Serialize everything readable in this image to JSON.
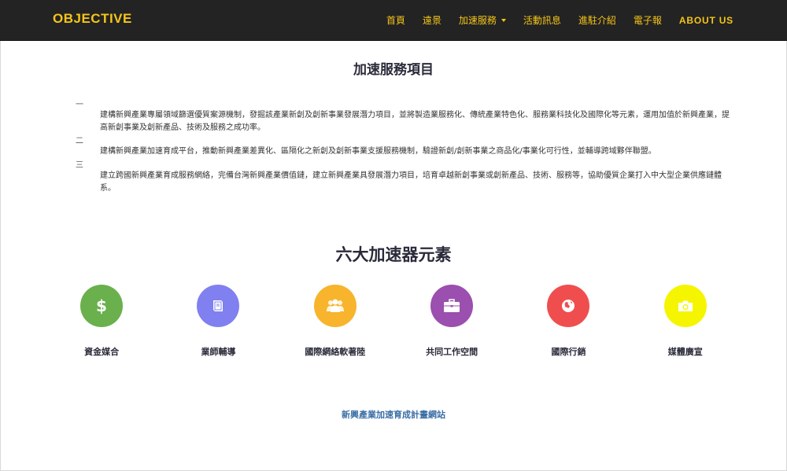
{
  "header": {
    "brand": "OBJECTIVE",
    "nav": [
      {
        "label": "首頁"
      },
      {
        "label": "遠景"
      },
      {
        "label": "加速服務"
      },
      {
        "label": "活動訊息"
      },
      {
        "label": "進駐介紹"
      },
      {
        "label": "電子報"
      },
      {
        "label": "ABOUT US"
      }
    ]
  },
  "services": {
    "title": "加速服務項目",
    "items": [
      {
        "num": "一",
        "text": "建構新興產業專屬領域篩選優質案源機制，發掘該產業新創及創新事業發展潛力項目，並將製造業服務化、傳統產業特色化、服務業科技化及國際化等元素，運用加值於新興產業，提高新創事業及創新產品、技術及服務之成功率。"
      },
      {
        "num": "二",
        "text": "建構新興產業加速育成平台，推動新興產業差異化、區隔化之新創及創新事業支援服務機制，驗證新創/創新事業之商品化/事業化可行性，並輔導跨域夥伴聯盟。"
      },
      {
        "num": "三",
        "text": "建立跨國新興產業育成服務網絡，完備台灣新興產業價值鏈，建立新興產業具發展潛力項目，培育卓越新創事業或創新產品、技術、服務等，協助優質企業打入中大型企業供應鏈體系。"
      }
    ]
  },
  "accelerators": {
    "title": "六大加速器元素",
    "items": [
      {
        "label": "資金媒合",
        "icon": "dollar-icon",
        "color": "#6ab04c"
      },
      {
        "label": "業師輔導",
        "icon": "book-icon",
        "color": "#8080f0"
      },
      {
        "label": "國際網絡軟著陸",
        "icon": "group-icon",
        "color": "#f7b42c"
      },
      {
        "label": "共同工作空間",
        "icon": "briefcase-icon",
        "color": "#9b4fae"
      },
      {
        "label": "國際行銷",
        "icon": "globe-icon",
        "color": "#f04e4e"
      },
      {
        "label": "媒體廣宣",
        "icon": "camera-icon",
        "color": "#f5f500"
      }
    ]
  },
  "footer": {
    "link": "新興產業加速育成計畫網站"
  }
}
